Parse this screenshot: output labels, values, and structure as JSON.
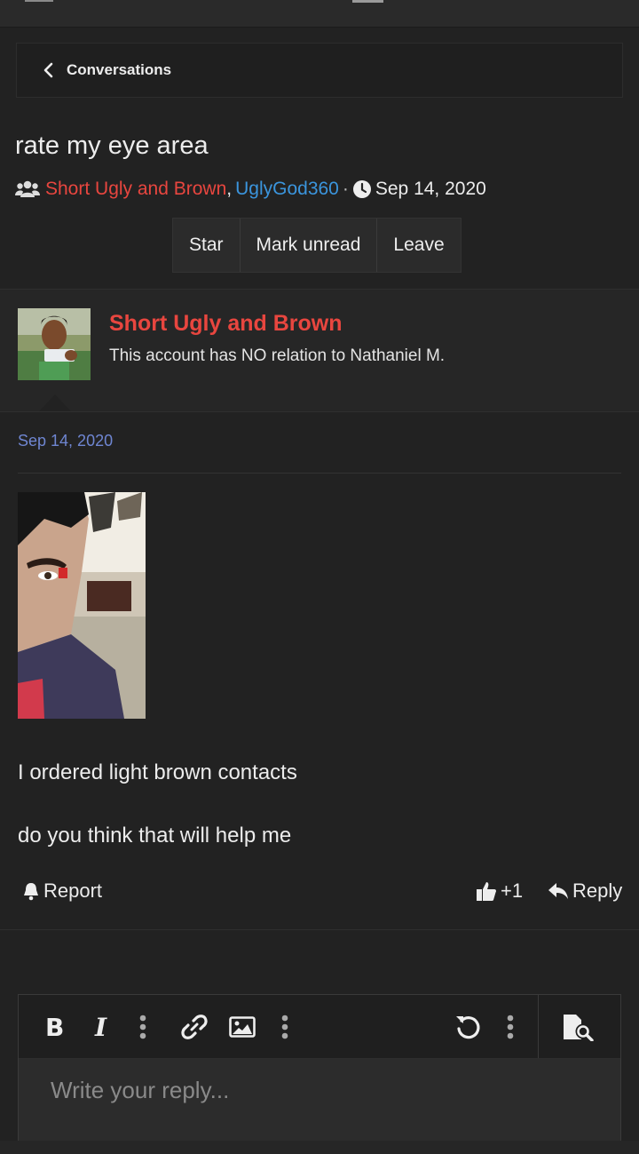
{
  "breadcrumb": {
    "label": "Conversations"
  },
  "conversation": {
    "title": "rate my eye area",
    "participants": [
      "Short Ugly and Brown",
      "UglyGod360"
    ],
    "participant_separator": ",",
    "dot": "·",
    "date": "Sep 14, 2020",
    "actions": [
      "Star",
      "Mark unread",
      "Leave"
    ]
  },
  "post": {
    "author": "Short Ugly and Brown",
    "author_title": "This account has NO relation to Nathaniel M.",
    "date": "Sep 14, 2020",
    "body": [
      "I ordered light brown contacts",
      "do you think that will help me"
    ],
    "report_label": "Report",
    "like_count": "+1",
    "reply_label": "Reply"
  },
  "editor": {
    "placeholder": "Write your reply..."
  },
  "colors": {
    "accent_red": "#e8463f",
    "accent_blue": "#3b95dd",
    "date_blue": "#6f86d2",
    "background": "#222222"
  }
}
